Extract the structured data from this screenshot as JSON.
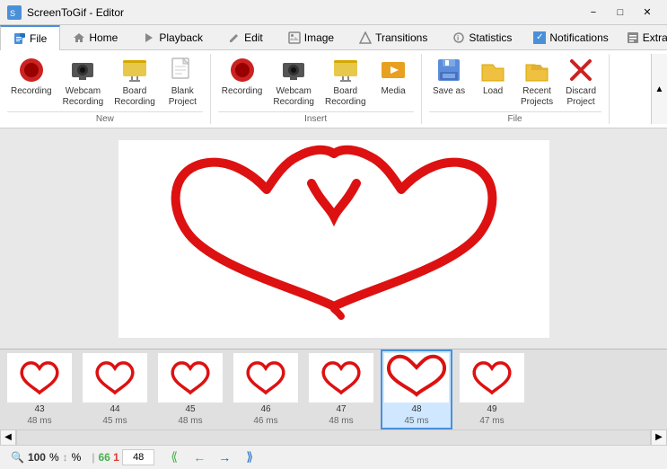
{
  "titleBar": {
    "title": "ScreenToGif - Editor",
    "minimizeLabel": "−",
    "maximizeLabel": "□",
    "closeLabel": "✕"
  },
  "tabs": {
    "items": [
      {
        "id": "file",
        "label": "File",
        "active": true,
        "icon": "💾"
      },
      {
        "id": "home",
        "label": "Home",
        "active": false,
        "icon": "🏠"
      },
      {
        "id": "playback",
        "label": "Playback",
        "active": false,
        "icon": "▶"
      },
      {
        "id": "edit",
        "label": "Edit",
        "active": false,
        "icon": "✏"
      },
      {
        "id": "image",
        "label": "Image",
        "active": false,
        "icon": "🖼"
      },
      {
        "id": "transitions",
        "label": "Transitions",
        "active": false,
        "icon": "⬡"
      },
      {
        "id": "statistics",
        "label": "Statistics",
        "active": false,
        "icon": "ℹ"
      }
    ],
    "rightItems": [
      {
        "id": "notifications",
        "label": "Notifications",
        "checked": true
      },
      {
        "id": "extras",
        "label": "Extras"
      }
    ]
  },
  "ribbon": {
    "groups": [
      {
        "id": "new",
        "label": "New",
        "items": [
          {
            "id": "recording",
            "label": "Recording",
            "icon": "recording"
          },
          {
            "id": "webcam-recording",
            "label": "Webcam\nRecording",
            "icon": "webcam"
          },
          {
            "id": "board-recording",
            "label": "Board\nRecording",
            "icon": "board"
          },
          {
            "id": "blank-project",
            "label": "Blank\nProject",
            "icon": "blank"
          }
        ]
      },
      {
        "id": "insert",
        "label": "Insert",
        "items": [
          {
            "id": "recording2",
            "label": "Recording",
            "icon": "recording"
          },
          {
            "id": "webcam-recording2",
            "label": "Webcam\nRecording",
            "icon": "webcam"
          },
          {
            "id": "board-recording2",
            "label": "Board\nRecording",
            "icon": "board"
          },
          {
            "id": "media",
            "label": "Media",
            "icon": "media"
          }
        ]
      },
      {
        "id": "file-ops",
        "label": "File",
        "items": [
          {
            "id": "save-as",
            "label": "Save as",
            "icon": "saveas"
          },
          {
            "id": "load",
            "label": "Load",
            "icon": "load"
          },
          {
            "id": "recent-projects",
            "label": "Recent\nProjects",
            "icon": "recent"
          },
          {
            "id": "discard-project",
            "label": "Discard\nProject",
            "icon": "discard"
          }
        ]
      }
    ],
    "collapseLabel": "▲"
  },
  "filmstrip": {
    "frames": [
      {
        "num": "43",
        "time": "48 ms",
        "active": false
      },
      {
        "num": "44",
        "time": "45 ms",
        "active": false
      },
      {
        "num": "45",
        "time": "48 ms",
        "active": false
      },
      {
        "num": "46",
        "time": "46 ms",
        "active": false
      },
      {
        "num": "47",
        "time": "48 ms",
        "active": false
      },
      {
        "num": "48",
        "time": "45 ms",
        "active": true
      },
      {
        "num": "49",
        "time": "47 ms",
        "active": false
      }
    ]
  },
  "statusBar": {
    "zoomIcon": "🔍",
    "zoomValue": "100",
    "zoomSuffix": "%",
    "frameCount": "66",
    "selectedFrame": "1",
    "frameTotal": "48",
    "navPrevPrev": "⟪",
    "navPrev": "←",
    "navNext": "→",
    "navNextNext": "⟫"
  }
}
